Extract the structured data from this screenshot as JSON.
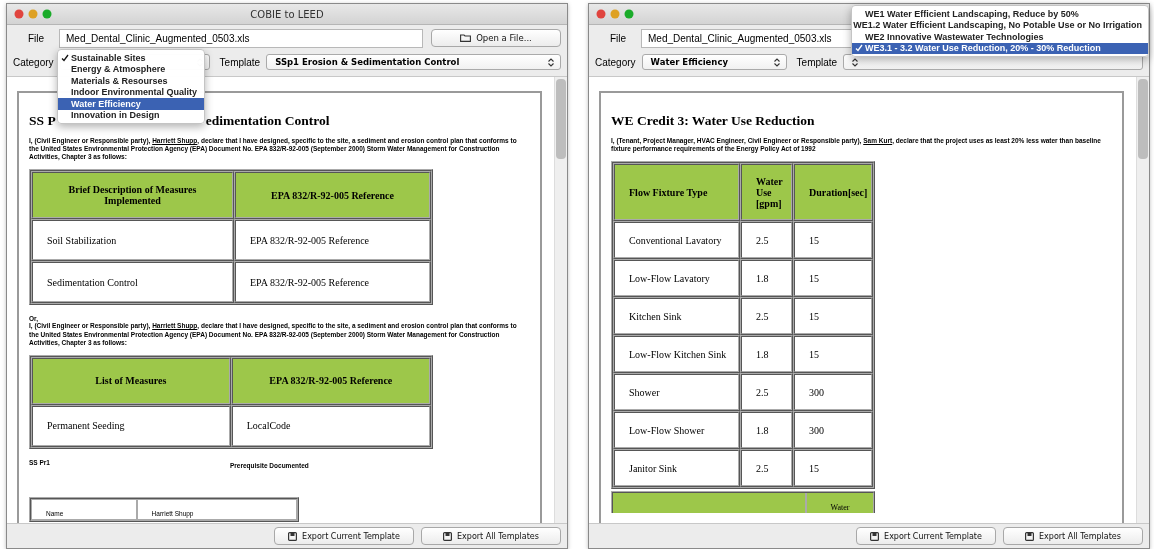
{
  "left_window": {
    "title": "COBIE to LEED",
    "file_label": "File",
    "file_value": "Med_Dental_Clinic_Augmented_0503.xls",
    "open_button": "Open a File...",
    "category_label": "Category",
    "template_label": "Template",
    "template_value": "SSp1 Erosion & Sedimentation Control",
    "category_menu": [
      {
        "label": "Sustainable Sites",
        "checked": true,
        "highlighted": false
      },
      {
        "label": "Energy & Atmosphere",
        "checked": false,
        "highlighted": false
      },
      {
        "label": "Materials & Resourses",
        "checked": false,
        "highlighted": false
      },
      {
        "label": "Indoor Environmental Quality",
        "checked": false,
        "highlighted": false
      },
      {
        "label": "Water Efficiency",
        "checked": false,
        "highlighted": true
      },
      {
        "label": "Innovation in Design",
        "checked": false,
        "highlighted": false
      }
    ],
    "document": [
      {
        "kind": "split_heading",
        "parts": [
          "SS P",
          "edimentation Control"
        ]
      },
      {
        "kind": "paragraph",
        "before": "I, (Civil Engineer or Responsible party), ",
        "name": "Harriett Shupp",
        "after": ", declare that I have designed, specific to the site, a sediment and erosion control plan that conforms to the United States Environmental Protection Agency (EPA) Document No. EPA 832/R-92-005 (September 2000) Storm Water Management for Construction Activities, Chapter 3 as follows:"
      },
      {
        "kind": "table",
        "columns": [
          "Brief Description of Measures Implemented",
          "EPA 832/R-92-005 Reference"
        ],
        "rows": [
          [
            "Soil Stabilization",
            "EPA 832/R-92-005 Reference"
          ],
          [
            "Sedimentation Control",
            "EPA 832/R-92-005 Reference"
          ]
        ]
      },
      {
        "kind": "text",
        "text": "Or,"
      },
      {
        "kind": "paragraph",
        "before": "I, (Civil Engineer or Responsible party), ",
        "name": "Harriett Shupp",
        "after": ", declare that I have designed, specific to the site, a sediment and erosion control plan that conforms to the United States Environmental Protection Agency (EPA) Document No. EPA 832/R-92-005 (September 2000) Storm Water Management for Construction Activities, Chapter 3 as follows:"
      },
      {
        "kind": "table",
        "columns": [
          "List of Measures",
          "EPA 832/R-92-005 Reference"
        ],
        "rows": [
          [
            "Permanent Seeding",
            "LocalCode"
          ]
        ]
      },
      {
        "kind": "caption_row",
        "left": "SS Pr1",
        "right": "Prerequisite Documented"
      },
      {
        "kind": "plain_table",
        "rows": [
          [
            "Name",
            "Harriett Shupp"
          ]
        ]
      }
    ],
    "buttons": [
      "Export Current Template",
      "Export All Templates"
    ]
  },
  "right_window": {
    "file_label": "File",
    "file_value": "Med_Dental_Clinic_Augmented_0503.xls",
    "category_label": "Category",
    "category_value": "Water Efficiency",
    "template_label": "Template",
    "template_menu": [
      {
        "label": "WE1 Water Efficient Landscaping, Reduce by 50%",
        "checked": false,
        "highlighted": false
      },
      {
        "label": "WE1.2 Water Efficient Landscaping, No Potable Use or No Irrigation",
        "checked": false,
        "highlighted": false
      },
      {
        "label": "WE2 Innovative Wastewater Technologies",
        "checked": false,
        "highlighted": false
      },
      {
        "label": "WE3.1 - 3.2 Water Use Reduction, 20% - 30% Reduction",
        "checked": true,
        "highlighted": true
      }
    ],
    "document": [
      {
        "kind": "heading",
        "text": "WE Credit 3: Water Use Reduction"
      },
      {
        "kind": "paragraph",
        "before": "I, (Tenant, Project Manager, HVAC Engineer, Civil Engineer or Responsible party), ",
        "name": "Sam Kurt",
        "after": ", declare that the project uses as least 20% less water than baseline fixture performance requirements of the Energy Policy Act of 1992"
      },
      {
        "kind": "table",
        "columns": [
          "Flow Fixture Type",
          "Water Use [gpm]",
          "Duration[sec]"
        ],
        "rows": [
          [
            "Conventional Lavatory",
            "2.5",
            "15"
          ],
          [
            "Low-Flow Lavatory",
            "1.8",
            "15"
          ],
          [
            "Kitchen Sink",
            "2.5",
            "15"
          ],
          [
            "Low-Flow Kitchen Sink",
            "1.8",
            "15"
          ],
          [
            "Shower",
            "2.5",
            "300"
          ],
          [
            "Low-Flow Shower",
            "1.8",
            "300"
          ],
          [
            "Janitor Sink",
            "2.5",
            "15"
          ]
        ]
      },
      {
        "kind": "cut_table_header",
        "column_2": "Water"
      }
    ],
    "buttons": [
      "Export Current Template",
      "Export All Templates"
    ]
  }
}
